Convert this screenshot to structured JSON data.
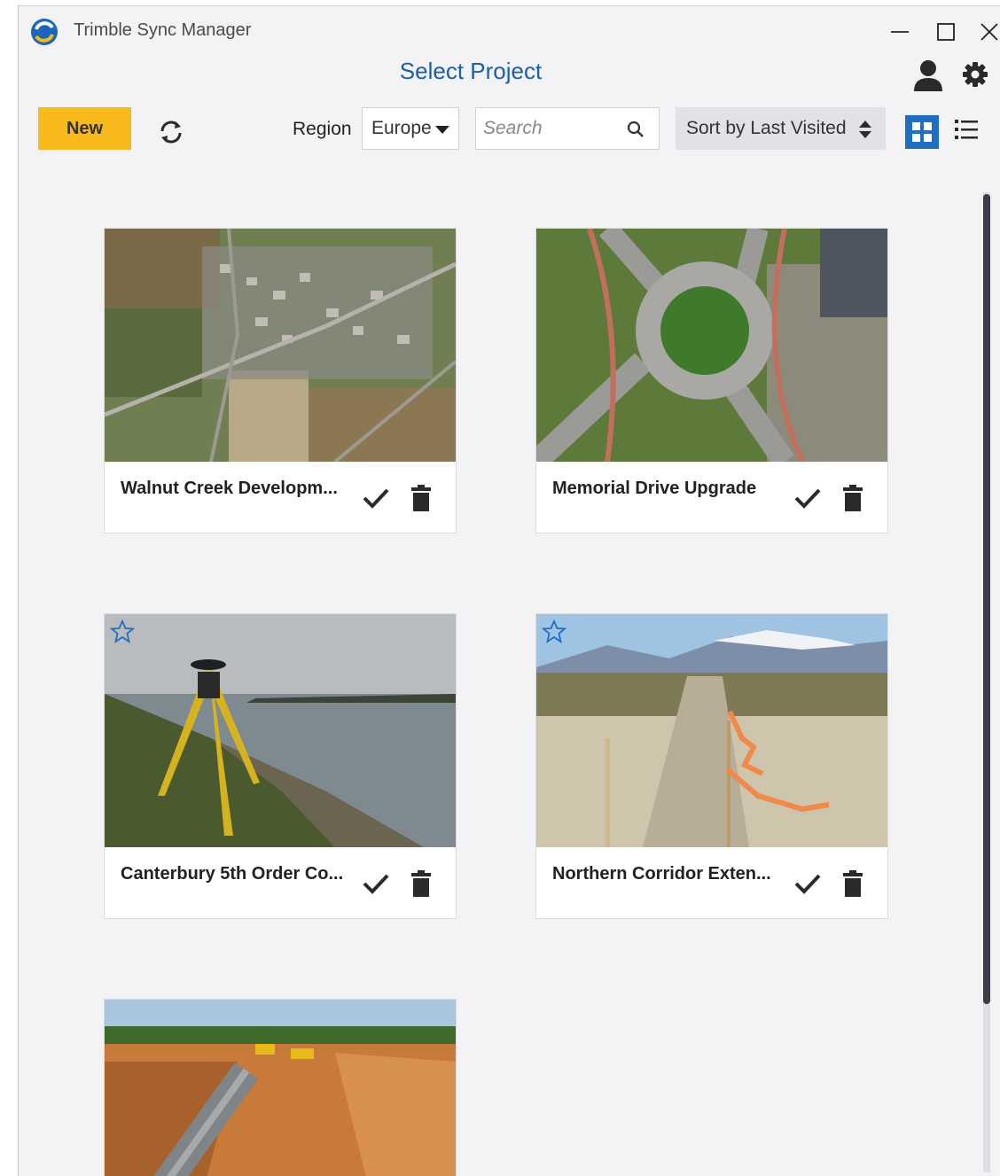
{
  "window": {
    "title": "Trimble Sync Manager"
  },
  "header": {
    "page_title": "Select Project"
  },
  "toolbar": {
    "new_label": "New",
    "region_label": "Region",
    "region_value": "Europe",
    "search_placeholder": "Search",
    "sort_value": "Sort by Last Visited"
  },
  "colors": {
    "accent": "#1c5ea8",
    "new_button": "#f8b91a",
    "view_toggle_active": "#1e6fc0"
  },
  "icons": {
    "app": "trimble-logo-icon",
    "minimize": "minimize-icon",
    "maximize": "maximize-icon",
    "close": "close-icon",
    "user": "user-icon",
    "settings": "gear-icon",
    "refresh": "refresh-icon",
    "search": "search-icon",
    "sort": "sort-arrows-icon",
    "grid_view": "grid-view-icon",
    "list_view": "list-view-icon",
    "favorite": "star-outline-icon",
    "open": "checkmark-icon",
    "delete": "trash-icon"
  },
  "projects": [
    {
      "name": "Walnut Creek Developm...",
      "image": "aerial-town",
      "favorite_star": false
    },
    {
      "name": "Memorial Drive Upgrade",
      "image": "aerial-roundabout",
      "favorite_star": false
    },
    {
      "name": "Canterbury 5th Order Co...",
      "image": "tripod-coast",
      "favorite_star": true
    },
    {
      "name": "Northern Corridor Exten...",
      "image": "construction-site",
      "favorite_star": true
    },
    {
      "name": "",
      "image": "pipeline-trench",
      "favorite_star": false
    }
  ]
}
